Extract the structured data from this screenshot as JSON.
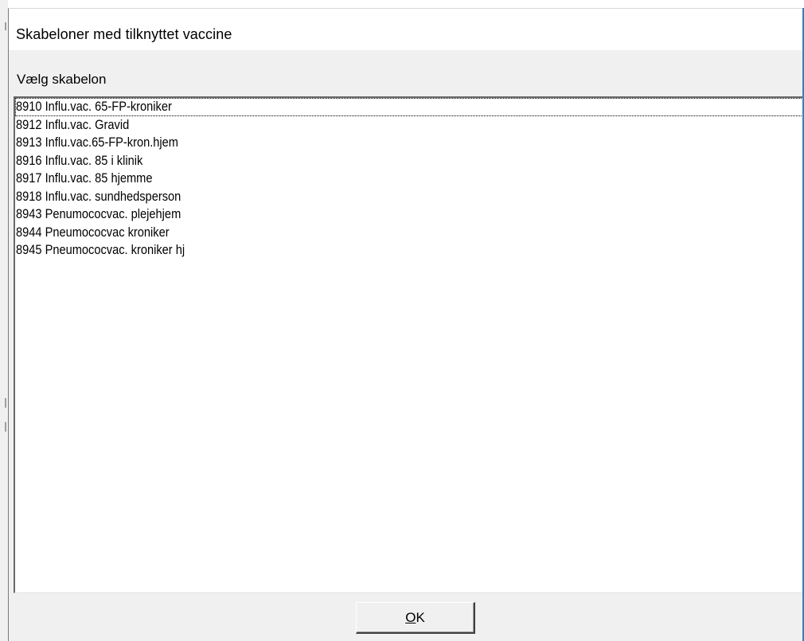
{
  "window": {
    "title": "Skabeloner med tilknyttet vaccine"
  },
  "group": {
    "label": "Vælg skabelon"
  },
  "list": {
    "items": [
      "8910 Influ.vac. 65-FP-kroniker",
      "8912 Influ.vac. Gravid",
      "8913 Influ.vac.65-FP-kron.hjem",
      "8916 Influ.vac. 85 i klinik",
      "8917 Influ.vac. 85 hjemme",
      "8918 Influ.vac. sundhedsperson",
      "8943 Penumococvac. plejehjem",
      "8944 Pneumococvac kroniker",
      "8945 Pneumococvac. kroniker hj"
    ],
    "focused_index": 0
  },
  "buttons": {
    "ok_label": "OK",
    "ok_mnemonic": "O",
    "ok_rest": "K"
  },
  "colors": {
    "dialog_bg": "#f0f0f0",
    "list_bg": "#ffffff",
    "frame_accent": "#3c7fb1"
  }
}
